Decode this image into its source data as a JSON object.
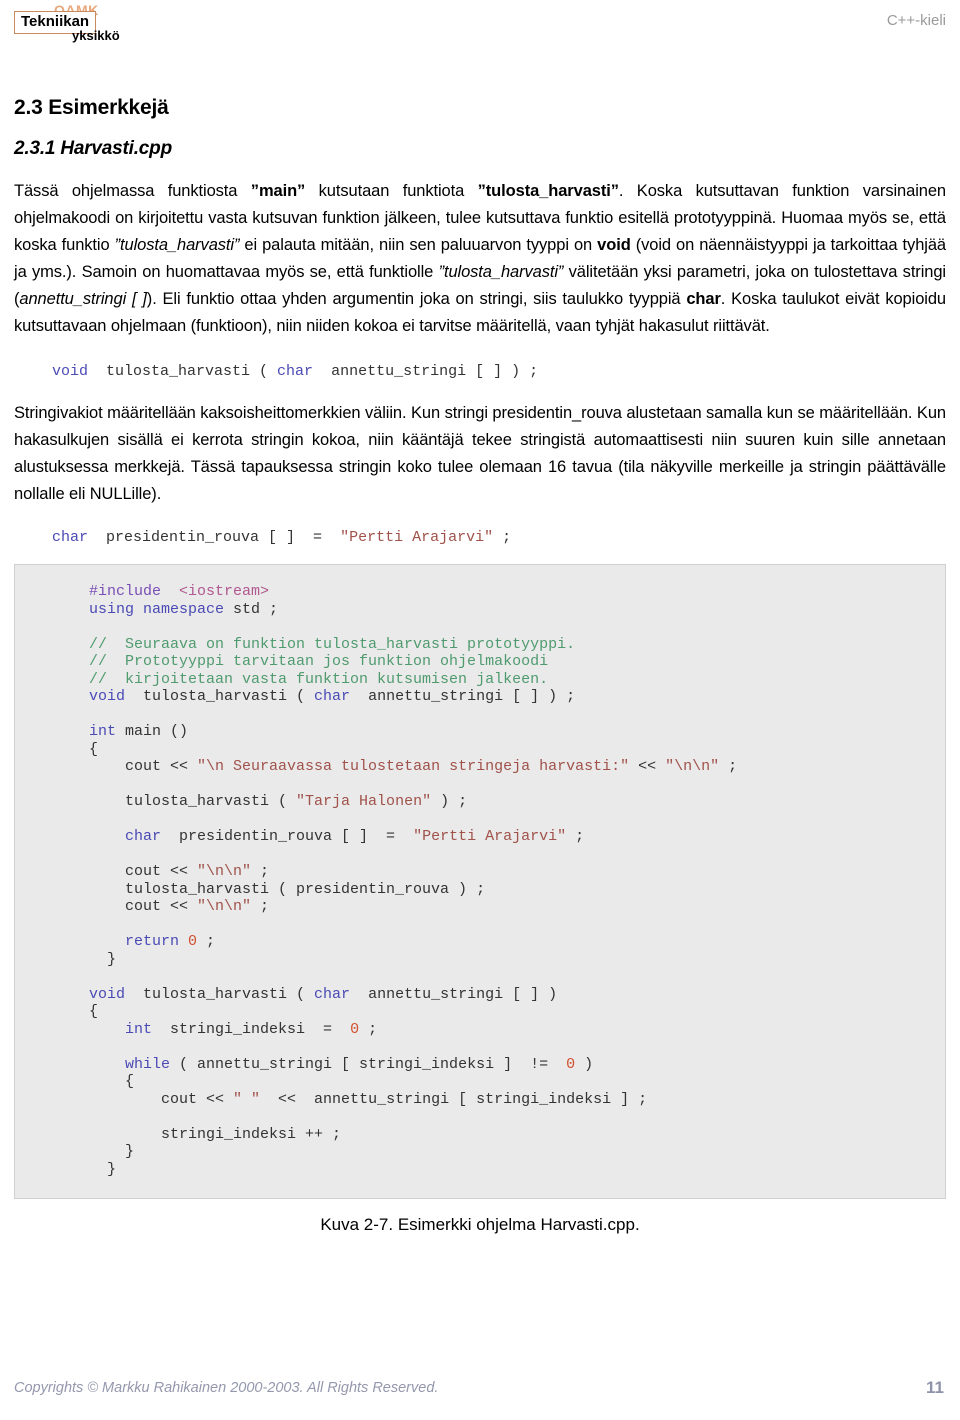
{
  "header": {
    "logo": {
      "oamk": "OAMK",
      "tekniikan": "Tekniikan",
      "yksikko": "yksikkö"
    },
    "right_label": "C++-kieli"
  },
  "headings": {
    "section": "2.3 Esimerkkejä",
    "subsection": "2.3.1 Harvasti.cpp"
  },
  "paragraph1": {
    "p1": "Tässä ohjelmassa funktiosta ",
    "main": "”main”",
    "p2": " kutsutaan funktiota ",
    "tulosta": "”tulosta_harvasti”",
    "p3": ". Koska kutsuttavan funktion varsinainen ohjelmakoodi on kirjoitettu vasta kutsuvan funktion jälkeen, tulee kutsuttava funktio esitellä prototyyppinä. Huomaa myös se, että koska funktio ",
    "tulosta_i": "”tulosta_harvasti”",
    "p4": " ei palauta mitään, niin sen paluuarvon tyyppi on ",
    "void": "void",
    "p5": " (void on näennäistyyppi ja tarkoittaa tyhjää ja yms.). Samoin on huomattavaa myös se, että funktiolle ",
    "tulosta_i2": "”tulosta_harvasti”",
    "p6": " välitetään yksi parametri, joka on tulostettava stringi (",
    "annettu": "annettu_stringi [ ]",
    "p7": "). Eli funktio ottaa yhden argumentin joka on stringi, siis taulukko tyyppiä ",
    "char": "char",
    "p8": ". Koska taulukot eivät kopioidu kutsuttavaan ohjelmaan (funktioon), niin niiden kokoa ei tarvitse määritellä, vaan tyhjät hakasulut riittävät."
  },
  "code_proto": {
    "kw_void": "void",
    "name": "  tulosta_harvasti ( ",
    "kw_char": "char",
    "rest": "  annettu_stringi [ ] ) ;"
  },
  "paragraph2": {
    "text": "Stringivakiot määritellään kaksoisheittomerkkien väliin. Kun stringi presidentin_rouva alustetaan samalla kun se määritellään. Kun hakasulkujen sisällä ei kerrota stringin kokoa, niin kääntäjä tekee stringistä automaattisesti niin suuren kuin sille annetaan alustuksessa merkkejä. Tässä tapauksessa stringin koko tulee olemaan 16 tavua (tila näkyville merkeille ja stringin päättävälle nollalle eli NULLille)."
  },
  "code_char": {
    "kw_char": "char",
    "mid": "  presidentin_rouva [ ]  =  ",
    "str": "\"Pertti Arajarvi\"",
    "end": " ;"
  },
  "code_block": [
    {
      "type": "line",
      "parts": [
        {
          "cls": "pre",
          "t": "#include"
        },
        {
          "cls": "",
          "t": "  "
        },
        {
          "cls": "inc",
          "t": "<iostream>"
        }
      ]
    },
    {
      "type": "line",
      "parts": [
        {
          "cls": "kw",
          "t": "using namespace"
        },
        {
          "cls": "",
          "t": " std ;"
        }
      ]
    },
    {
      "type": "blank"
    },
    {
      "type": "line",
      "parts": [
        {
          "cls": "cmt",
          "t": "//  Seuraava on funktion tulosta_harvasti prototyyppi."
        }
      ]
    },
    {
      "type": "line",
      "parts": [
        {
          "cls": "cmt",
          "t": "//  Prototyyppi tarvitaan jos funktion ohjelmakoodi"
        }
      ]
    },
    {
      "type": "line",
      "parts": [
        {
          "cls": "cmt",
          "t": "//  kirjoitetaan vasta funktion kutsumisen jalkeen."
        }
      ]
    },
    {
      "type": "line",
      "parts": [
        {
          "cls": "kw",
          "t": "void"
        },
        {
          "cls": "",
          "t": "  tulosta_harvasti ( "
        },
        {
          "cls": "kw",
          "t": "char"
        },
        {
          "cls": "",
          "t": "  annettu_stringi [ ] ) ;"
        }
      ]
    },
    {
      "type": "blank"
    },
    {
      "type": "line",
      "parts": [
        {
          "cls": "kw",
          "t": "int"
        },
        {
          "cls": "",
          "t": " main ()"
        }
      ]
    },
    {
      "type": "line",
      "parts": [
        {
          "cls": "",
          "t": "{"
        }
      ]
    },
    {
      "type": "line",
      "parts": [
        {
          "cls": "",
          "t": "    cout << "
        },
        {
          "cls": "str",
          "t": "\"\\n Seuraavassa tulostetaan stringeja harvasti:\""
        },
        {
          "cls": "",
          "t": " << "
        },
        {
          "cls": "str",
          "t": "\"\\n\\n\""
        },
        {
          "cls": "",
          "t": " ;"
        }
      ]
    },
    {
      "type": "blank"
    },
    {
      "type": "line",
      "parts": [
        {
          "cls": "",
          "t": "    tulosta_harvasti ( "
        },
        {
          "cls": "str",
          "t": "\"Tarja Halonen\""
        },
        {
          "cls": "",
          "t": " ) ;"
        }
      ]
    },
    {
      "type": "blank"
    },
    {
      "type": "line",
      "parts": [
        {
          "cls": "kw",
          "t": "    char"
        },
        {
          "cls": "",
          "t": "  presidentin_rouva [ ]  =  "
        },
        {
          "cls": "str",
          "t": "\"Pertti Arajarvi\""
        },
        {
          "cls": "",
          "t": " ;"
        }
      ]
    },
    {
      "type": "blank"
    },
    {
      "type": "line",
      "parts": [
        {
          "cls": "",
          "t": "    cout << "
        },
        {
          "cls": "str",
          "t": "\"\\n\\n\""
        },
        {
          "cls": "",
          "t": " ;"
        }
      ]
    },
    {
      "type": "line",
      "parts": [
        {
          "cls": "",
          "t": "    tulosta_harvasti ( presidentin_rouva ) ;"
        }
      ]
    },
    {
      "type": "line",
      "parts": [
        {
          "cls": "",
          "t": "    cout << "
        },
        {
          "cls": "str",
          "t": "\"\\n\\n\""
        },
        {
          "cls": "",
          "t": " ;"
        }
      ]
    },
    {
      "type": "blank"
    },
    {
      "type": "line",
      "parts": [
        {
          "cls": "kw",
          "t": "    return"
        },
        {
          "cls": "num",
          "t": " 0"
        },
        {
          "cls": "",
          "t": " ;"
        }
      ]
    },
    {
      "type": "line",
      "parts": [
        {
          "cls": "",
          "t": "  }"
        }
      ]
    },
    {
      "type": "blank"
    },
    {
      "type": "line",
      "parts": [
        {
          "cls": "kw",
          "t": "void"
        },
        {
          "cls": "",
          "t": "  tulosta_harvasti ( "
        },
        {
          "cls": "kw",
          "t": "char"
        },
        {
          "cls": "",
          "t": "  annettu_stringi [ ] )"
        }
      ]
    },
    {
      "type": "line",
      "parts": [
        {
          "cls": "",
          "t": "{"
        }
      ]
    },
    {
      "type": "line",
      "parts": [
        {
          "cls": "kw",
          "t": "    int"
        },
        {
          "cls": "",
          "t": "  stringi_indeksi  =  "
        },
        {
          "cls": "num",
          "t": "0"
        },
        {
          "cls": "",
          "t": " ;"
        }
      ]
    },
    {
      "type": "blank"
    },
    {
      "type": "line",
      "parts": [
        {
          "cls": "kw",
          "t": "    while"
        },
        {
          "cls": "",
          "t": " ( annettu_stringi [ stringi_indeksi ]  !=  "
        },
        {
          "cls": "num",
          "t": "0"
        },
        {
          "cls": "",
          "t": " )"
        }
      ]
    },
    {
      "type": "line",
      "parts": [
        {
          "cls": "",
          "t": "    {"
        }
      ]
    },
    {
      "type": "line",
      "parts": [
        {
          "cls": "",
          "t": "        cout << "
        },
        {
          "cls": "str",
          "t": "\" \""
        },
        {
          "cls": "",
          "t": "  <<  annettu_stringi [ stringi_indeksi ] ;"
        }
      ]
    },
    {
      "type": "blank"
    },
    {
      "type": "line",
      "parts": [
        {
          "cls": "",
          "t": "        stringi_indeksi ++ ;"
        }
      ]
    },
    {
      "type": "line",
      "parts": [
        {
          "cls": "",
          "t": "    }"
        }
      ]
    },
    {
      "type": "line",
      "parts": [
        {
          "cls": "",
          "t": "  }"
        }
      ]
    }
  ],
  "figure_caption": "Kuva 2-7. Esimerkki ohjelma Harvasti.cpp.",
  "footer": {
    "copyright": "Copyrights © Markku Rahikainen 2000-2003. All Rights Reserved.",
    "page_number": "11"
  }
}
